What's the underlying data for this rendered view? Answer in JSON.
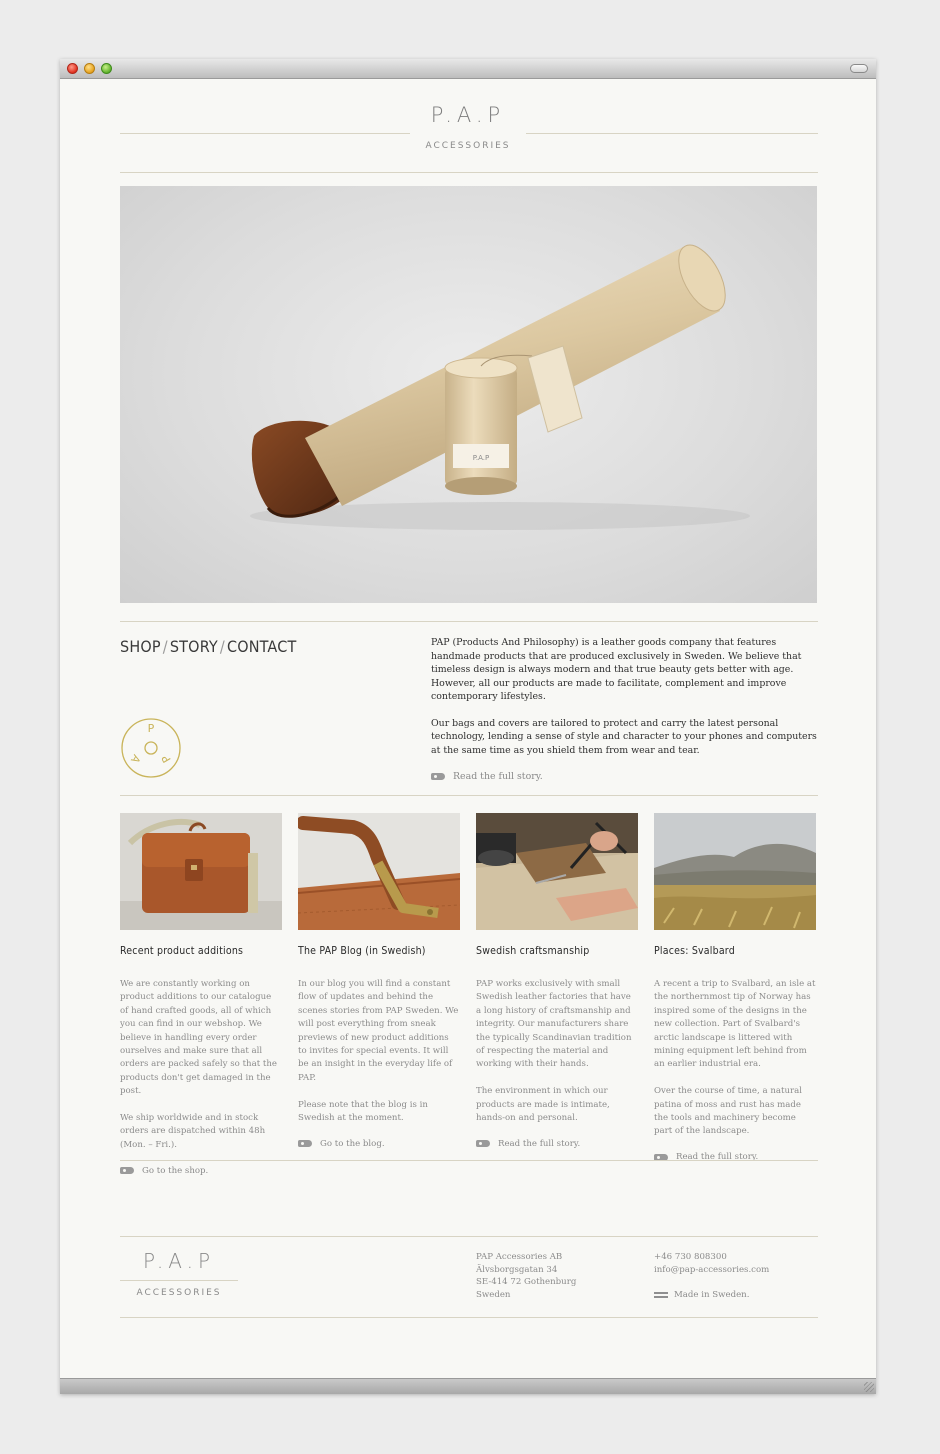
{
  "brand": {
    "logo": "P.A.P",
    "tagline": "ACCESSORIES"
  },
  "nav": {
    "shop": "SHOP",
    "story": "STORY",
    "contact": "CONTACT",
    "separator": "/"
  },
  "seal": {
    "letters": [
      "P",
      "A",
      "P"
    ]
  },
  "intro": {
    "p1": "PAP (Products And Philosophy) is a leather goods company that features handmade products that are produced exclusively in Sweden. We believe that timeless design is always modern and that true beauty gets better with age. However, all our products are made to facilitate, complement and improve contemporary lifestyles.",
    "p2": "Our bags and covers are tailored to protect and carry the latest personal technology, lending a sense of style and character to your phones and computers at the same time as you shield them from wear and tear.",
    "link": "Read the full story."
  },
  "cards": [
    {
      "title": "Recent product additions",
      "p1": "We are constantly working on product additions to our catalogue of hand crafted goods, all of which you can find in our webshop. We believe in handling every order ourselves and make sure that all orders are packed safely so that the products don't get damaged in the post.",
      "p2": "We ship worldwide and in stock orders are dispatched within 48h (Mon. – Fri.).",
      "link": "Go to the shop."
    },
    {
      "title": "The PAP Blog (in Swedish)",
      "p1": "In our blog you will find a constant flow of updates and behind the scenes stories from PAP Sweden. We will post everything from sneak previews of new product additions to invites for special events. It will be an insight in the everyday life of PAP.",
      "p2": "Please note that the blog is in Swedish at the moment.",
      "link": "Go to the blog."
    },
    {
      "title": "Swedish craftsmanship",
      "p1": "PAP works exclusively with small Swedish leather factories that have a long history of craftsmanship and integrity. Our manufacturers share the typically Scandinavian tradition of respecting the material and working with their hands.",
      "p2": "The environment in which our products are made is intimate, hands-on and personal.",
      "link": "Read the full story."
    },
    {
      "title": "Places: Svalbard",
      "p1": "A recent a trip to Svalbard, an isle at the northernmost tip of Norway has inspired some of the designs in the new collection. Part of Svalbard's arctic landscape is littered with mining equipment left behind from an earlier industrial era.",
      "p2": "Over the course of time, a natural patina of moss and rust has made the tools and machinery become part of the landscape.",
      "link": "Read the full story."
    }
  ],
  "footer": {
    "logo": "P.A.P",
    "tagline": "ACCESSORIES",
    "address": [
      "PAP Accessories AB",
      "Älvsborgsgatan 34",
      "SE-414 72 Gothenburg",
      "Sweden"
    ],
    "phone": "+46 730 808300",
    "email": "info@pap-accessories.com",
    "made_in": "Made in Sweden."
  },
  "colors": {
    "background": "#f8f8f5",
    "rule": "#d8d4c4",
    "seal_gold": "#c9b45a",
    "text_dark": "#2f2f2f",
    "text_muted": "#8b8b8b"
  }
}
